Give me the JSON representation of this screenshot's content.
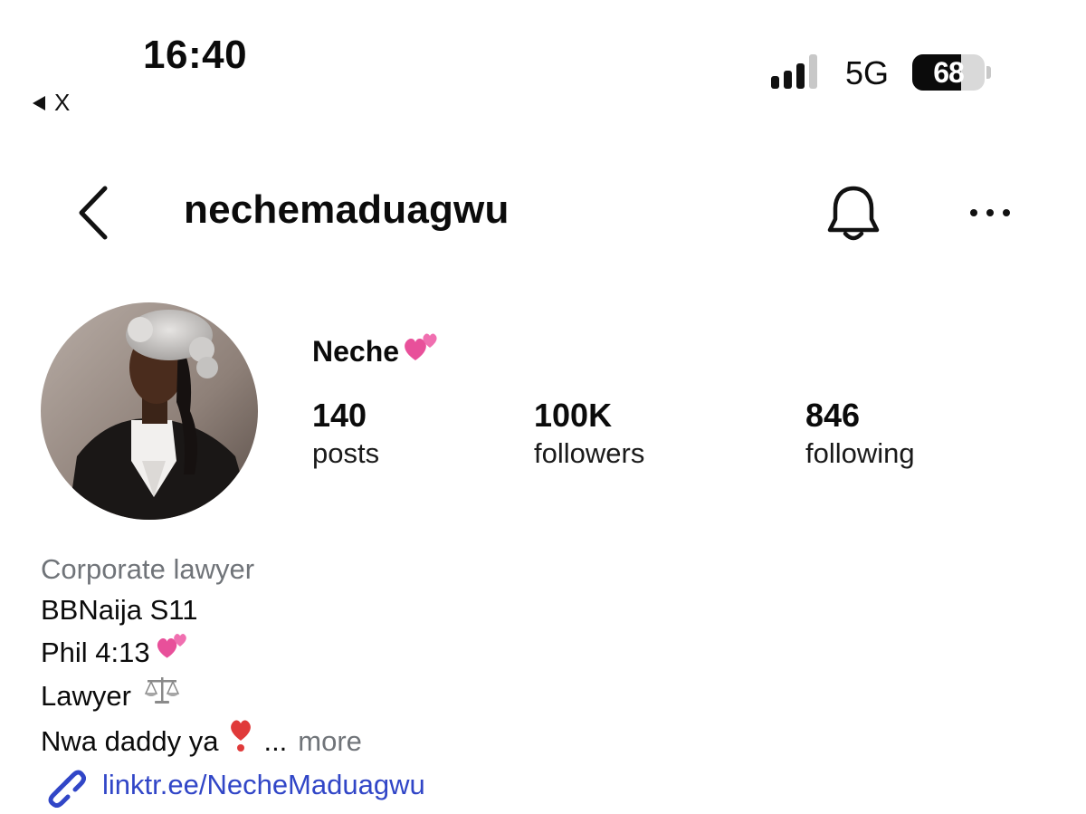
{
  "status_bar": {
    "time": "16:40",
    "back_app_label": "X",
    "network": "5G",
    "battery_level": "68",
    "signal_bars_active": 3,
    "signal_bars_total": 4
  },
  "header": {
    "username": "nechemaduagwu"
  },
  "profile": {
    "display_name": "Neche",
    "stats": [
      {
        "value": "140",
        "label": "posts"
      },
      {
        "value": "100K",
        "label": "followers"
      },
      {
        "value": "846",
        "label": "following"
      }
    ]
  },
  "bio": {
    "category": "Corporate lawyer",
    "lines": [
      "BBNaija S11",
      "Phil 4:13",
      "Lawyer",
      "Nwa daddy ya"
    ],
    "ellipsis": "...",
    "more_label": "more",
    "link": "linktr.ee/NecheMaduagwu"
  },
  "colors": {
    "link": "#3146c7",
    "muted": "#707479",
    "text": "#0b0b0b"
  },
  "icons": [
    "chevron-left-icon",
    "bell-icon",
    "more-dots-icon",
    "link-icon",
    "two-hearts-icon",
    "scales-icon",
    "exclamation-heart-icon"
  ]
}
